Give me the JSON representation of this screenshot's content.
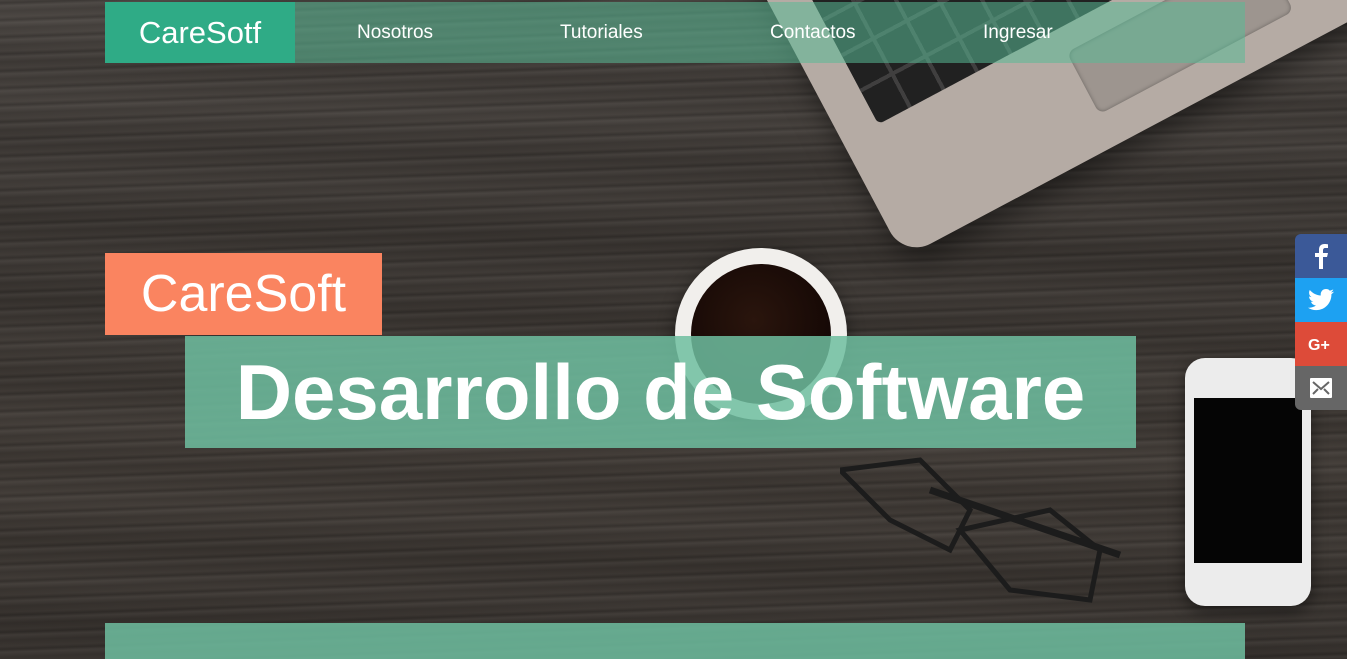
{
  "navbar": {
    "brand": "CareSotf",
    "items": [
      {
        "label": "Nosotros"
      },
      {
        "label": "Tutoriales"
      },
      {
        "label": "Contactos"
      },
      {
        "label": "Ingresar"
      }
    ]
  },
  "hero": {
    "badge": "CareSoft",
    "title": "Desarrollo de Software"
  },
  "social": [
    {
      "icon": "facebook-icon",
      "color": "#3b5998"
    },
    {
      "icon": "twitter-icon",
      "color": "#1da1f2"
    },
    {
      "icon": "google-plus-icon",
      "color": "#dd4b39"
    },
    {
      "icon": "mail-icon",
      "color": "#666666"
    }
  ],
  "colors": {
    "brand": "#2fab86",
    "badge": "#fa8460",
    "panel": "#6ebea0"
  }
}
